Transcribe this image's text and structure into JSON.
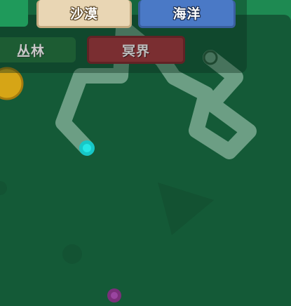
{
  "biome_tabs": {
    "desert": "沙漠",
    "ocean": "海洋",
    "jungle": "丛林",
    "nether": "冥界"
  },
  "colors": {
    "grass_light": "#1e8a52",
    "grass_dark": "#145a37",
    "trail": "#9bc3ae",
    "player": "#1fd8d8",
    "enemy": "#8a3a8a",
    "coin": "#d6a516"
  },
  "icons": {
    "player": "cyan-ball-icon",
    "enemy": "purple-ball-icon",
    "coin": "gold-coin-icon"
  }
}
